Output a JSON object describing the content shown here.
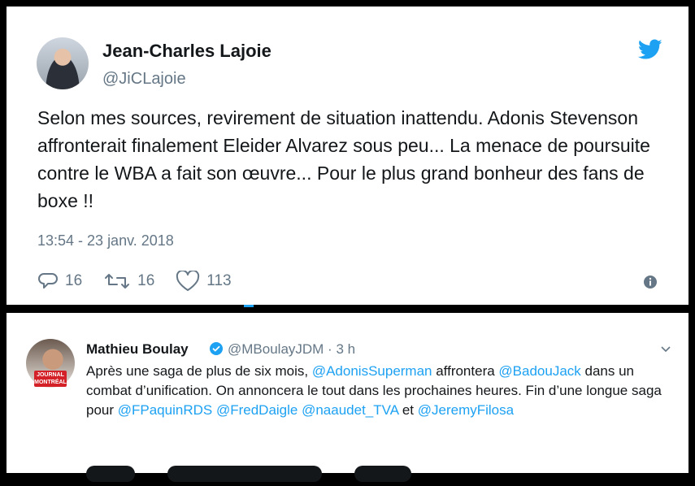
{
  "tweet1": {
    "author_name": "Jean-Charles Lajoie",
    "author_handle": "@JiCLajoie",
    "text": "Selon mes sources, revirement de situation inattendu. Adonis Stevenson affronterait finalement Eleider Alvarez sous peu... La menace de poursuite contre le WBA a fait son œuvre... Pour le plus grand bonheur des fans de boxe !!",
    "timestamp": "13:54 - 23 janv. 2018",
    "replies": "16",
    "retweets": "16",
    "likes": "113"
  },
  "tweet2": {
    "author_name": "Mathieu Boulay",
    "author_meta": "@MBoulayJDM · 3 h",
    "avatar_badge": "JOURNAL MONTRÉAL",
    "text_parts": {
      "p1": "Après une saga de plus de six mois, ",
      "m1": "@AdonisSuperman",
      "p2": " affrontera ",
      "m2": "@BadouJack",
      "p3": " dans un combat d’unification. On annoncera le tout dans les prochaines heures. Fin d’une longue saga pour ",
      "m3": "@FPaquinRDS",
      "p4": " ",
      "m4": "@FredDaigle",
      "p5": " ",
      "m5": "@naaudet_TVA",
      "p6": " et ",
      "m6": "@JeremyFilosa"
    }
  },
  "colors": {
    "text": "#14171a",
    "muted": "#657786",
    "accent": "#1da1f2",
    "background": "#000000"
  },
  "icons": [
    "twitter-bird-icon",
    "reply-icon",
    "retweet-icon",
    "like-icon",
    "info-icon",
    "verified-icon",
    "chevron-down-icon"
  ]
}
